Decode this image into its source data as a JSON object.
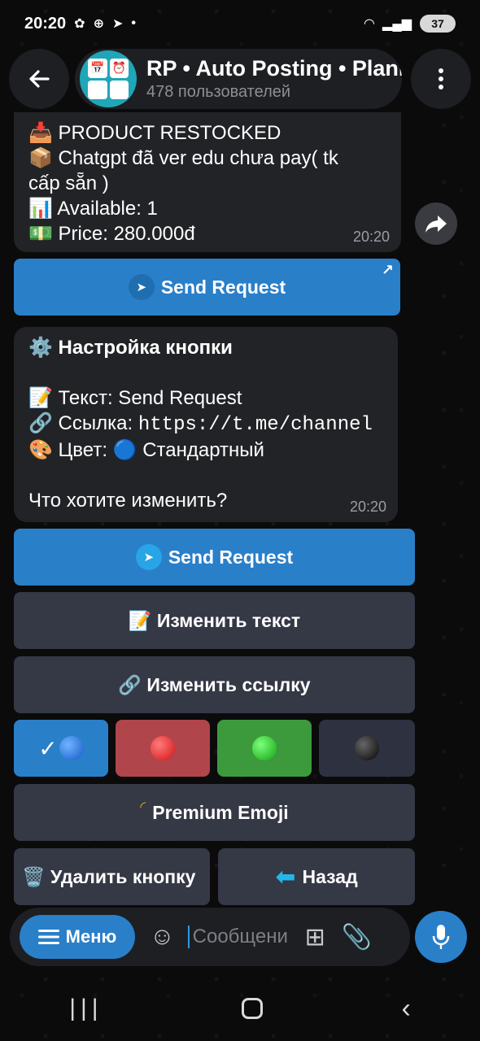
{
  "status_bar": {
    "time": "20:20",
    "battery": "37"
  },
  "header": {
    "title": "RP • Auto Posting • Planner",
    "subtitle": "478 пользователей"
  },
  "messages": {
    "product": {
      "line1": "📥 PRODUCT RESTOCKED",
      "line2": "📦 Chatgpt đã ver edu chưa pay( tk",
      "line3": "cấp sẵn )",
      "line4": "📊 Available: 1",
      "line5": "💵 Price: 280.000đ",
      "time": "20:20"
    },
    "settings": {
      "line1": "⚙️ Настройка кнопки",
      "line2": "📝 Текст: Send Request",
      "line3_prefix": "🔗 Ссылка: ",
      "line3_link": "https://t.me/channel",
      "line4": "🎨 Цвет: 🔵 Стандартный",
      "line5": "Что хотите изменить?",
      "time": "20:20"
    }
  },
  "inline_buttons": {
    "preview": "Send Request",
    "send_request": "Send Request",
    "edit_text": "📝 Изменить текст",
    "edit_link": "🔗 Изменить ссылку",
    "color_check": "✓",
    "premium_emoji": "Premium Emoji",
    "delete_button": "🗑️ Удалить кнопку",
    "back_arrow": "⬅",
    "back": "Назад"
  },
  "input_bar": {
    "menu_label": "Меню",
    "placeholder": "Сообщение"
  },
  "colors": {
    "accent": "#2a7fc9",
    "bubble": "#222326",
    "keyboard_button": "#353845"
  }
}
